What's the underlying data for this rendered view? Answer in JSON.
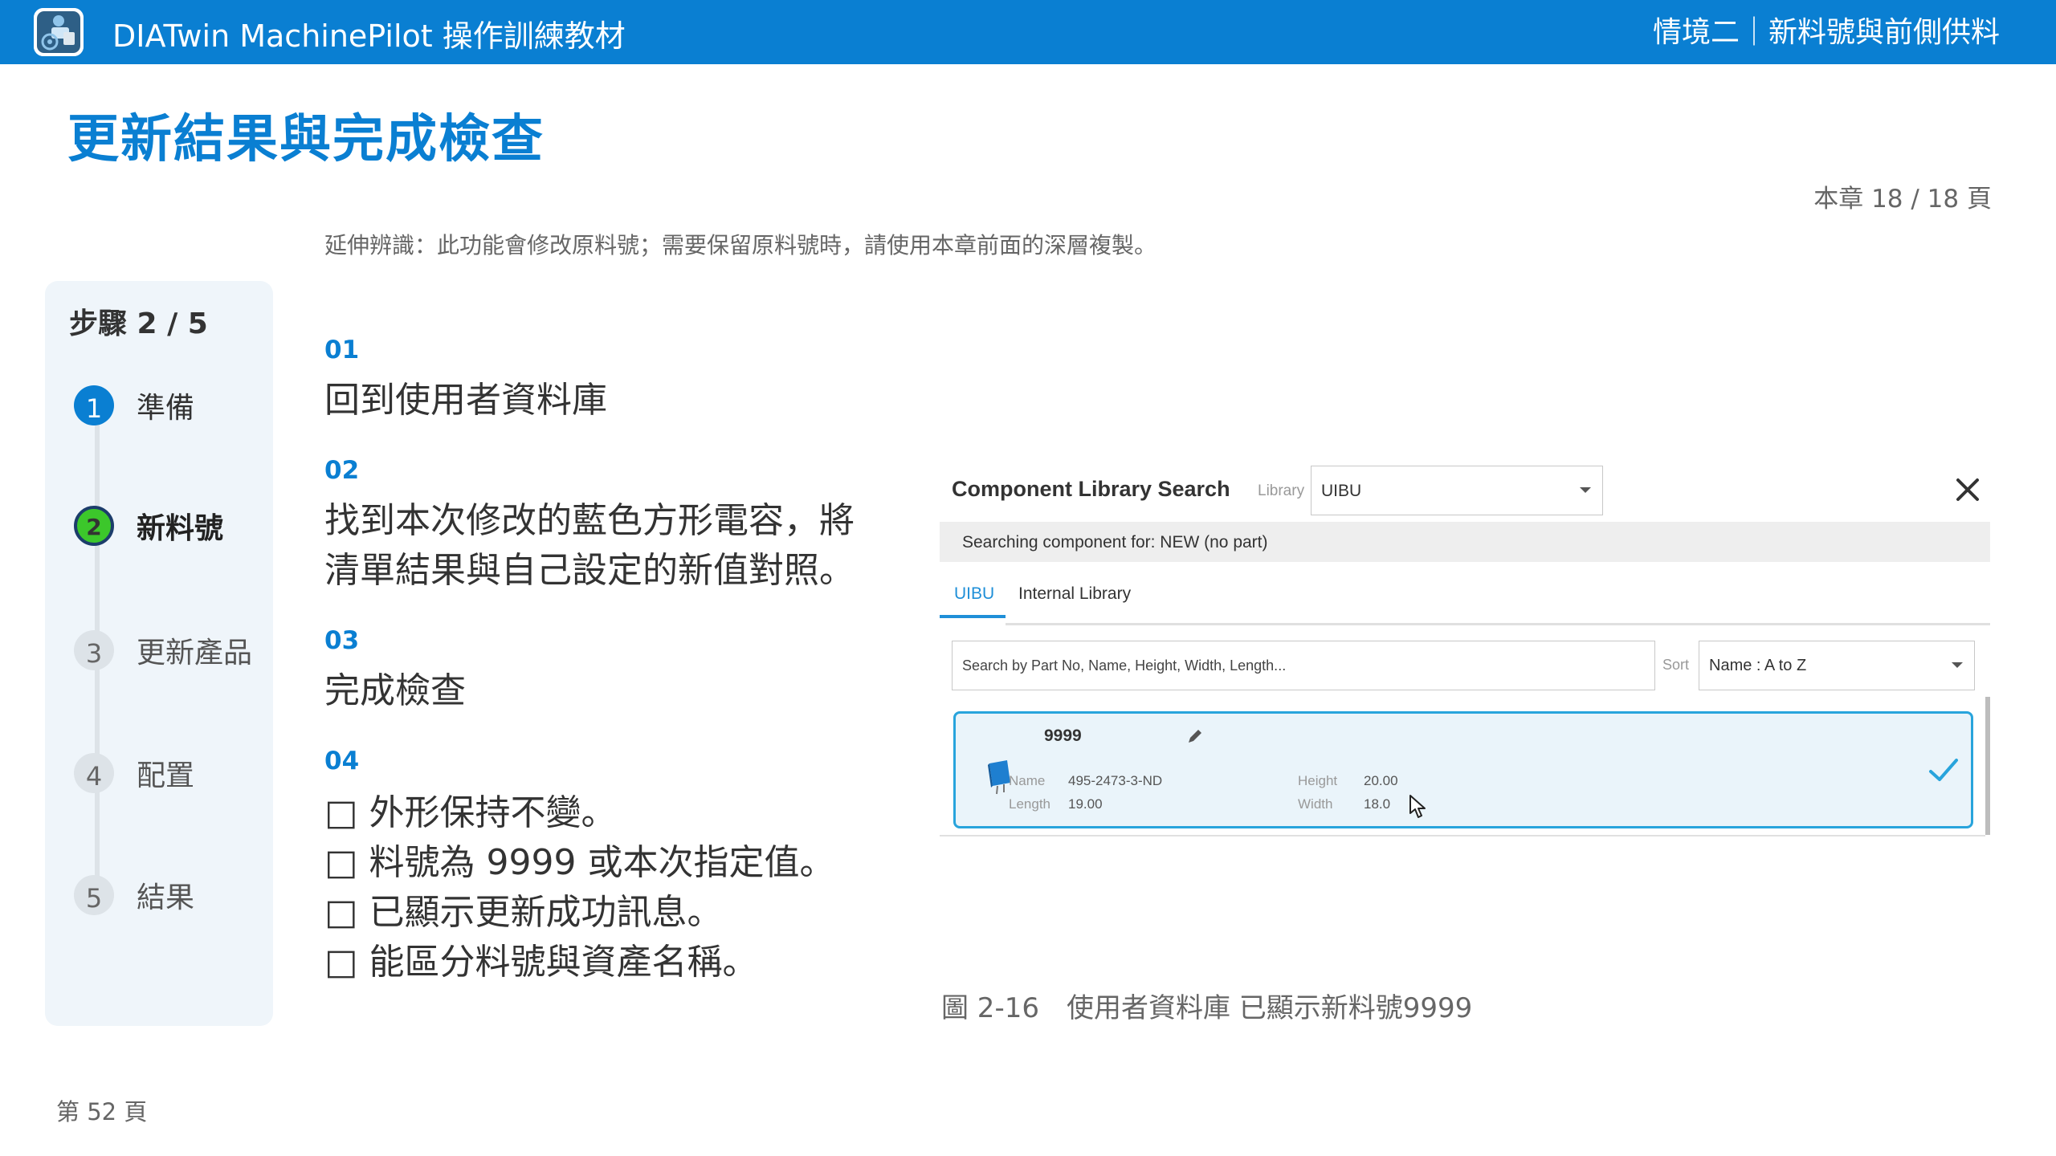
{
  "header": {
    "app_title": "DIATwin MachinePilot 操作訓練教材",
    "chapter": "情境二｜新料號與前側供料"
  },
  "page": {
    "title": "更新結果與完成檢查",
    "chapter_page": "本章 18 / 18 頁",
    "note": "延伸辨識：此功能會修改原料號；需要保留原料號時，請使用本章前面的深層複製。",
    "footer": "第 52 頁"
  },
  "sidebar": {
    "step_count": "步驟 2 / 5",
    "steps": [
      {
        "num": "1",
        "label": "準備",
        "state": "done"
      },
      {
        "num": "2",
        "label": "新料號",
        "state": "active"
      },
      {
        "num": "3",
        "label": "更新產品",
        "state": "pending"
      },
      {
        "num": "4",
        "label": "配置",
        "state": "pending"
      },
      {
        "num": "5",
        "label": "結果",
        "state": "pending"
      }
    ]
  },
  "steps": [
    {
      "num": "01",
      "text": "回到使用者資料庫"
    },
    {
      "num": "02",
      "lines": [
        "找到本次修改的藍色方形電容，將",
        "清單結果與自己設定的新值對照。"
      ]
    },
    {
      "num": "03",
      "text": "完成檢查"
    },
    {
      "num": "04",
      "checklist": [
        "□ 外形保持不變。",
        "□ 料號為 9999 或本次指定值。",
        "□ 已顯示更新成功訊息。",
        "□ 能區分料號與資產名稱。"
      ]
    }
  ],
  "screenshot": {
    "title": "Component Library Search",
    "library_label": "Library",
    "library_value": "UIBU",
    "info": "Searching component for: NEW (no part)",
    "tabs": [
      "UIBU",
      "Internal Library"
    ],
    "search_placeholder": "Search by Part No, Name, Height, Width, Length...",
    "sort_label": "Sort",
    "sort_value": "Name : A to Z",
    "result": {
      "part_no": "9999",
      "name_label": "Name",
      "name_value": "495-2473-3-ND",
      "length_label": "Length",
      "length_value": "19.00",
      "height_label": "Height",
      "height_value": "20.00",
      "width_label": "Width",
      "width_value": "18.0"
    }
  },
  "caption": "圖 2-16　使用者資料庫 已顯示新料號9999",
  "colors": {
    "brand": "#0a7fd2",
    "active_step": "#3cc72b",
    "selected_card_border": "#28a4dc",
    "selected_card_fill": "#eaf4fa"
  },
  "icons": [
    "app-logo-icon",
    "close-icon",
    "pencil-icon",
    "capacitor-icon",
    "checkmark-icon",
    "cursor-icon",
    "chevron-down-icon"
  ]
}
